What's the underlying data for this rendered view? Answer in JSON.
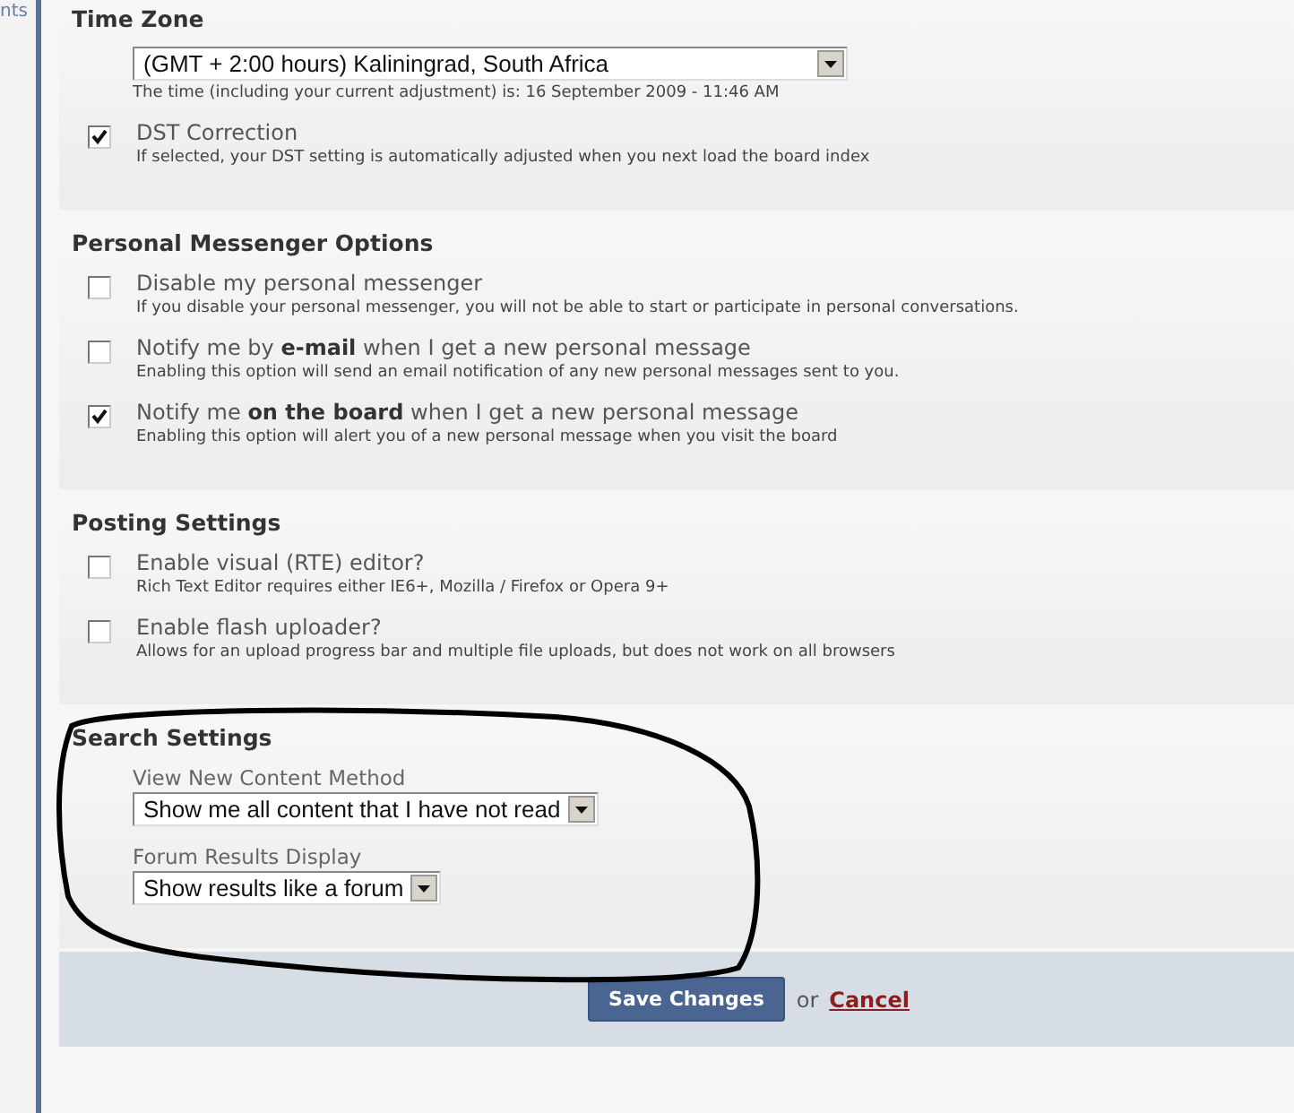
{
  "sidebar": {
    "text": "nts"
  },
  "sections": [
    {
      "title": "Time Zone",
      "items": [
        {
          "kind": "select",
          "value": "(GMT + 2:00 hours) Kaliningrad, South Africa",
          "hint": "The time (including your current adjustment) is: 16 September 2009 - 11:46 AM"
        },
        {
          "kind": "checkbox",
          "label": "DST Correction",
          "checked": true,
          "description": "If selected, your DST setting is automatically adjusted when you next load the board index"
        }
      ]
    },
    {
      "title": "Personal Messenger Options",
      "items": [
        {
          "kind": "checkbox",
          "label": "Disable my personal messenger",
          "checked": false,
          "description": "If you disable your personal messenger, you will not be able to start or participate in personal conversations."
        },
        {
          "kind": "checkbox",
          "label": "Notify me by **e-mail** when I get a new personal message",
          "checked": false,
          "description": "Enabling this option will send an email notification of any new personal messages sent to you."
        },
        {
          "kind": "checkbox",
          "label": "Notify me **on the board** when I get a new personal message",
          "checked": true,
          "description": "Enabling this option will alert you of a new personal message when you visit the board"
        }
      ]
    },
    {
      "title": "Posting Settings",
      "items": [
        {
          "kind": "checkbox",
          "label": "Enable visual (RTE) editor?",
          "checked": false,
          "description": "Rich Text Editor requires either IE6+, Mozilla / Firefox or Opera 9+"
        },
        {
          "kind": "checkbox",
          "label": "Enable flash uploader?",
          "checked": false,
          "description": "Allows for an upload progress bar and multiple file uploads, but does not work on all browsers"
        }
      ]
    },
    {
      "title": "Search Settings",
      "items": [
        {
          "kind": "select",
          "label": "View New Content Method",
          "value": "Show me all content that I have not read"
        },
        {
          "kind": "select",
          "label": "Forum Results Display",
          "value": "Show results like a forum"
        }
      ]
    }
  ],
  "footer": {
    "save_button": "Save Changes",
    "separator": "or",
    "cancel_link": "Cancel"
  }
}
